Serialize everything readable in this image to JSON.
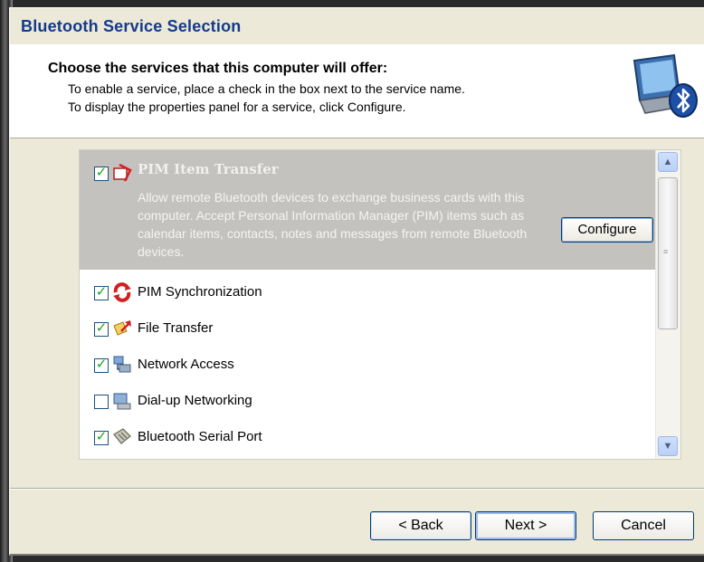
{
  "window": {
    "title": "Bluetooth Service Selection"
  },
  "header": {
    "title": "Choose the services that this computer will offer:",
    "line1": "To enable a service, place a check in the box next to the service name.",
    "line2": "To display the properties panel for a service, click Configure.",
    "icon": "bluetooth-computer-icon"
  },
  "services": {
    "selected": {
      "label": "PIM Item Transfer",
      "checked": true,
      "description": "Allow remote Bluetooth devices to exchange business cards with this computer. Accept Personal Information Manager (PIM) items such as calendar items, contacts, notes and messages from remote Bluetooth devices.",
      "configure_label": "Configure",
      "icon": "pim-transfer-icon"
    },
    "items": [
      {
        "label": "PIM Synchronization",
        "checked": true,
        "icon": "pim-sync-icon"
      },
      {
        "label": "File Transfer",
        "checked": true,
        "icon": "file-transfer-icon"
      },
      {
        "label": "Network Access",
        "checked": true,
        "icon": "network-access-icon"
      },
      {
        "label": "Dial-up Networking",
        "checked": false,
        "icon": "dialup-icon"
      },
      {
        "label": "Bluetooth Serial Port",
        "checked": true,
        "icon": "serial-port-icon"
      }
    ]
  },
  "buttons": {
    "back": "< Back",
    "next": "Next >",
    "cancel": "Cancel"
  },
  "colors": {
    "title": "#143a8c",
    "selection": "#c4c2be",
    "checkmark": "#21a121",
    "dialog": "#ece9d8"
  }
}
